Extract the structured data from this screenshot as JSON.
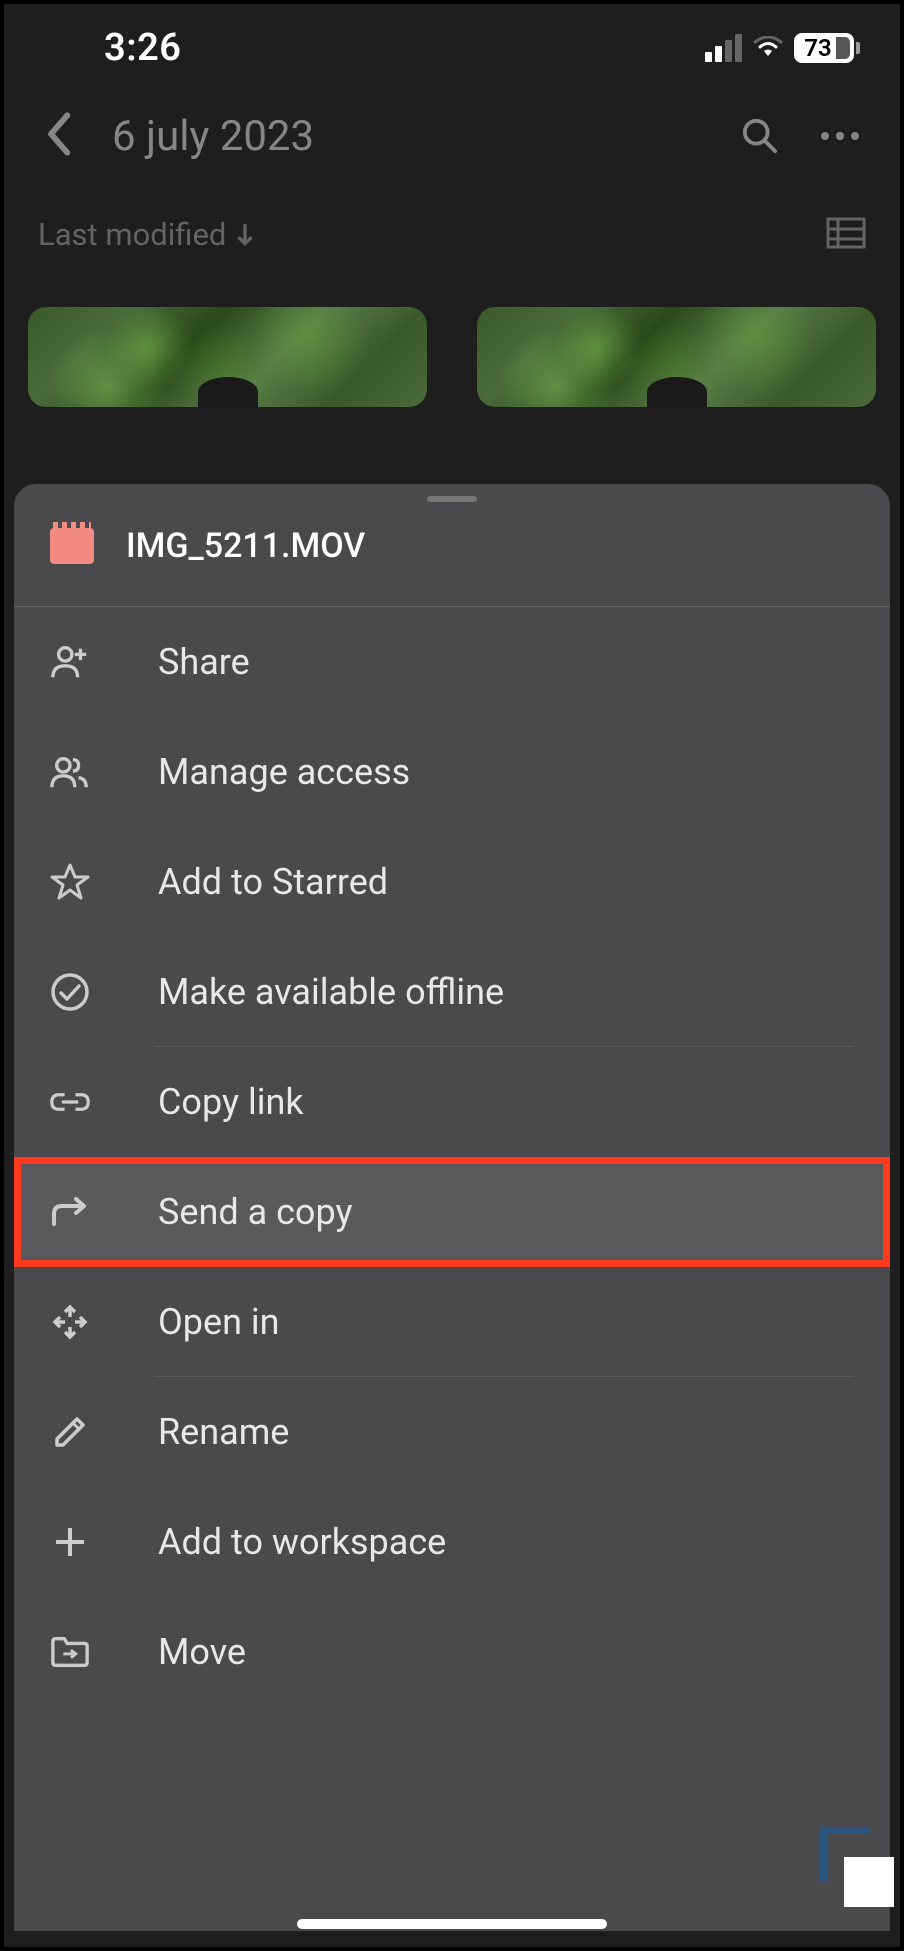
{
  "status": {
    "time": "3:26",
    "battery_pct": "73"
  },
  "header": {
    "title": "6 july 2023"
  },
  "sort": {
    "label": "Last modified"
  },
  "sheet": {
    "filename": "IMG_5211.MOV",
    "menu": {
      "share": "Share",
      "manage_access": "Manage access",
      "add_starred": "Add to Starred",
      "offline": "Make available offline",
      "copy_link": "Copy link",
      "send_copy": "Send a copy",
      "open_in": "Open in",
      "rename": "Rename",
      "add_workspace": "Add to workspace",
      "move": "Move"
    }
  }
}
